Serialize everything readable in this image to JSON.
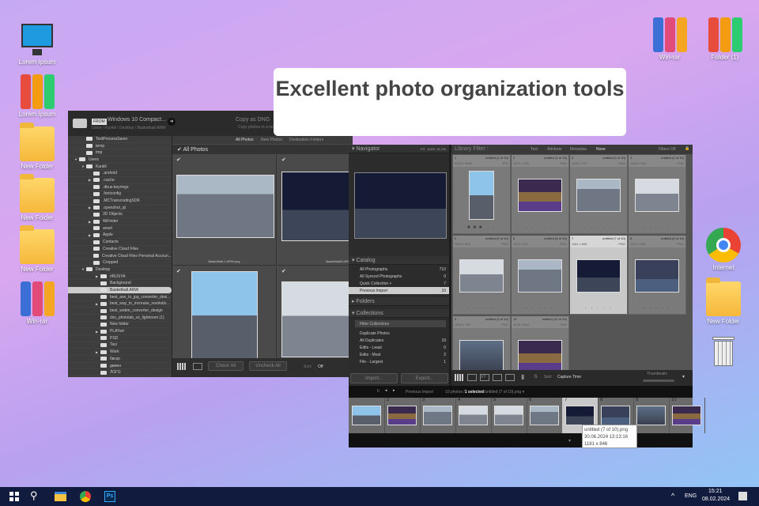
{
  "headline": "Excellent photo organization tools",
  "desktop_left": [
    {
      "label": "Lorem Ipsum",
      "icon": "computer-icon"
    },
    {
      "label": "Lorem Ipsum",
      "icon": "binders-icon"
    },
    {
      "label": "New Folder",
      "icon": "folder-icon"
    },
    {
      "label": "New Folder",
      "icon": "folder-icon"
    },
    {
      "label": "New Folder",
      "icon": "folder-icon"
    },
    {
      "label": "Win-rar",
      "icon": "winrar-icon"
    }
  ],
  "desktop_right": {
    "winrar": "Win-rar",
    "folder1": "Folder (1)",
    "internet": "Internet",
    "new_folder": "New Folder"
  },
  "import_window": {
    "from_badge": "FROM",
    "source": "Windows 10 Compact...",
    "path": "Users \\ Kunkli \\ Desktop \\ Basketball.ARW",
    "mode": "Copy as DNG",
    "mode_sub": "Copy photos to a ne",
    "tabs": [
      "All Photos",
      "New Photos",
      "Destination Folders"
    ],
    "grid_title": "All Photos",
    "tree": [
      {
        "l": "TestProcessSaver",
        "d": 1
      },
      {
        "l": "temp",
        "d": 1
      },
      {
        "l": "tmp",
        "d": 1
      },
      {
        "l": "Users",
        "d": 0,
        "a": "▼"
      },
      {
        "l": "Kunkli",
        "d": 1,
        "a": "▼"
      },
      {
        "l": ".android",
        "d": 2
      },
      {
        "l": ".cache",
        "d": 2,
        "a": "▶"
      },
      {
        "l": ".dbus-keyrings",
        "d": 2
      },
      {
        "l": ".fontconfig",
        "d": 2
      },
      {
        "l": ".MCTranscodingSDK",
        "d": 2
      },
      {
        "l": ".openshot_qt",
        "d": 2,
        "a": "▶"
      },
      {
        "l": "3D Objects",
        "d": 2
      },
      {
        "l": "4kFinder",
        "d": 2,
        "a": "▶"
      },
      {
        "l": "ansel",
        "d": 2
      },
      {
        "l": "Apple",
        "d": 2,
        "a": "▶"
      },
      {
        "l": "Contacts",
        "d": 2
      },
      {
        "l": "Creative Cloud Files",
        "d": 2
      },
      {
        "l": "Creative Cloud Files Personal Accoun...",
        "d": 2
      },
      {
        "l": "Cropped",
        "d": 2
      },
      {
        "l": "Desktop",
        "d": 1,
        "a": "▼"
      },
      {
        "l": "#RUSYA",
        "d": 3,
        "a": "▶"
      },
      {
        "l": "Background",
        "d": 3
      },
      {
        "l": "Basketball.ARW",
        "d": 3,
        "sel": true
      },
      {
        "l": "best_arw_to_jpg_converter_desi...",
        "d": 3
      },
      {
        "l": "best_way_to_increase_resolutio...",
        "d": 3,
        "a": "▶"
      },
      {
        "l": "best_webm_converter_design",
        "d": 3
      },
      {
        "l": "dxo_photolab_vs_lightroom (1)",
        "d": 3
      },
      {
        "l": "New folder",
        "d": 3
      },
      {
        "l": "PLAYart",
        "d": 3,
        "a": "▶"
      },
      {
        "l": "PSD",
        "d": 3
      },
      {
        "l": "Taxi",
        "d": 3
      },
      {
        "l": "Work",
        "d": 3,
        "a": "▶"
      },
      {
        "l": "6вскр",
        "d": 3
      },
      {
        "l": "дкмен",
        "d": 3
      },
      {
        "l": "ЛОГО",
        "d": 3
      }
    ],
    "photos": [
      "Basketball-1.ARW.png",
      "Basketball3.ARW.png",
      "",
      ""
    ],
    "check_all": "Check All",
    "uncheck_all": "Uncheck All",
    "sort_label": "Sort:",
    "sort_value": "Off"
  },
  "library": {
    "navigator": "Navigator",
    "nav_zoom": [
      "FIT",
      "100%",
      "91.2%"
    ],
    "catalog": "Catalog",
    "catalog_items": [
      {
        "l": "All Photographs",
        "n": "710"
      },
      {
        "l": "All Synced Photographs",
        "n": "0"
      },
      {
        "l": "Quick Collection +",
        "n": "7"
      },
      {
        "l": "Previous Import",
        "n": "10"
      }
    ],
    "folders": "Folders",
    "collections": "Collections",
    "filter_collections": "Filter Collections",
    "collection_items": [
      {
        "l": "Duplicate Photos",
        "n": ""
      },
      {
        "l": "All Duplicates",
        "n": "19"
      },
      {
        "l": "Edits - Least",
        "n": "0"
      },
      {
        "l": "Edits - Most",
        "n": "2"
      },
      {
        "l": "File - Largest",
        "n": "1"
      }
    ],
    "import": "Import...",
    "export": "Export...",
    "filter_title": "Library Filter :",
    "filters": [
      "Text",
      "Attribute",
      "Metadata",
      "None"
    ],
    "filters_off": "Filters Off",
    "cells": [
      {
        "n": "1",
        "t": "untitled (1 of 10)",
        "d": "5333 x 8000",
        "ty": "JPG",
        "stars": "★★★ · ·"
      },
      {
        "n": "2",
        "t": "untitled (2 of 10)",
        "d": "1271 x 793",
        "ty": "PNG",
        "stars": "· · · · ·"
      },
      {
        "n": "3",
        "t": "untitled (3 of 10)",
        "d": "1099 x 707",
        "ty": "PNG",
        "stars": "· · · · ·"
      },
      {
        "n": "4",
        "t": "untitled (4 of 10)",
        "d": "1544 x 949",
        "ty": "PNG",
        "stars": "· · · · ·"
      },
      {
        "n": "5",
        "t": "untitled (5 of 10)",
        "d": "1049 x 809",
        "ty": "PNG",
        "stars": "· · · · ·"
      },
      {
        "n": "6",
        "t": "untitled (6 of 10)",
        "d": "1407 x 911",
        "ty": "PNG",
        "stars": "· · · · ·"
      },
      {
        "n": "7",
        "t": "untitled (7 of 10)",
        "d": "1181 x 846",
        "ty": "PNG",
        "stars": "· · · · ·"
      },
      {
        "n": "8",
        "t": "untitled (8 of 10)",
        "d": "1213 x 952",
        "ty": "PNG",
        "stars": "· · · · ·"
      },
      {
        "n": "9",
        "t": "untitled (9 of 10)",
        "d": "1205 x 799",
        "ty": "PNG",
        "stars": ""
      },
      {
        "n": "10",
        "t": "untitled (10 of 10)",
        "d": "1079 x 844",
        "ty": "PNG",
        "stars": ""
      }
    ],
    "sort_label": "Sort:",
    "sort_value": "Capture Time",
    "thumbnails": "Thumbnails",
    "filmstrip_source": "Previous Import",
    "filmstrip_info": "10 photos /",
    "filmstrip_selected": "1 selected",
    "filmstrip_file": "/untitled (7 of 10).png",
    "film_numbers": [
      "",
      "2",
      "3",
      "4",
      "5",
      "6",
      "7",
      "8",
      "9",
      "10"
    ],
    "tooltip": [
      "untitled (7 of 10).png",
      "30.06.2024 13:13:16",
      "1181 x 846"
    ]
  },
  "taskbar": {
    "lang": "ENG",
    "time": "15:21",
    "date": "08.02.2024"
  }
}
